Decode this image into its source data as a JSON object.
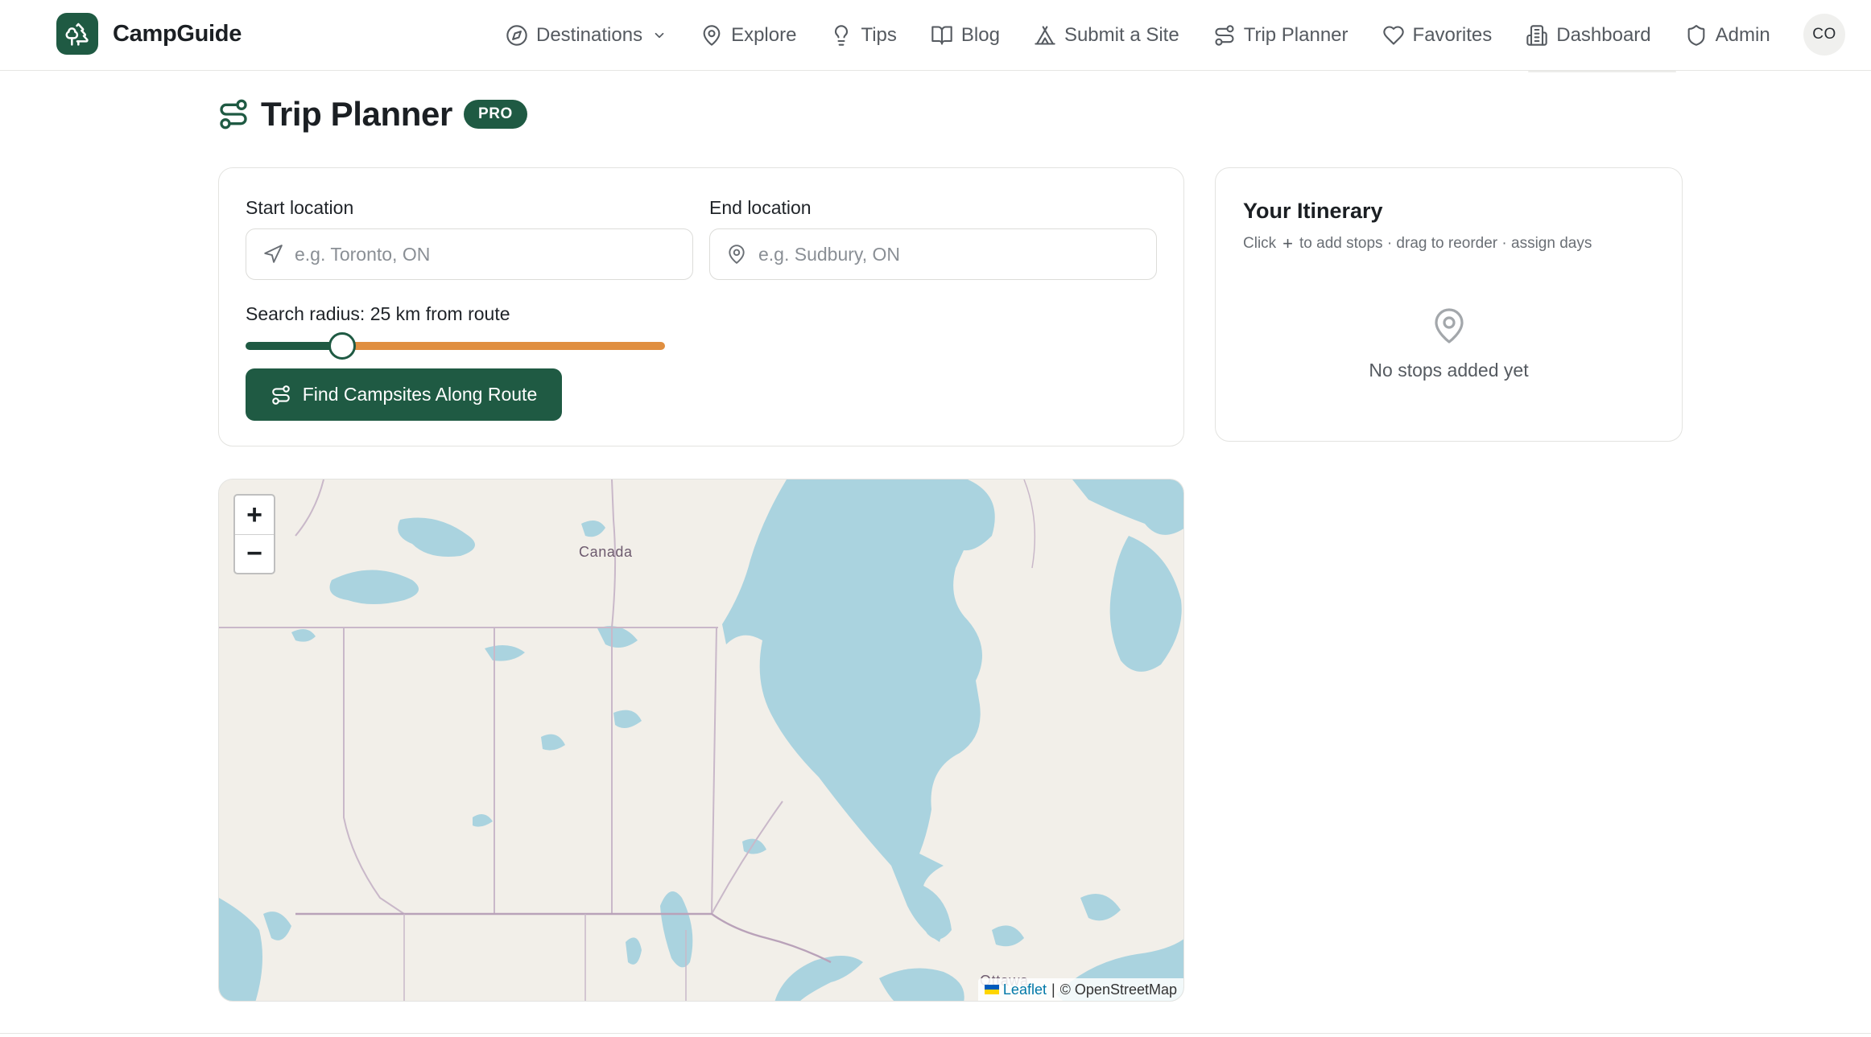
{
  "brand": {
    "name": "CampGuide"
  },
  "nav": {
    "items": [
      {
        "label": "Destinations",
        "icon": "compass-icon"
      },
      {
        "label": "Explore",
        "icon": "map-pin-icon"
      },
      {
        "label": "Tips",
        "icon": "lightbulb-icon"
      },
      {
        "label": "Blog",
        "icon": "book-icon"
      },
      {
        "label": "Submit a Site",
        "icon": "tent-icon"
      },
      {
        "label": "Trip Planner",
        "icon": "route-icon"
      },
      {
        "label": "Favorites",
        "icon": "heart-icon"
      },
      {
        "label": "Dashboard",
        "icon": "building-icon"
      },
      {
        "label": "Admin",
        "icon": "shield-icon"
      }
    ],
    "avatar_initials": "CO"
  },
  "page": {
    "title": "Trip Planner",
    "badge": "PRO"
  },
  "route_form": {
    "start_label": "Start location",
    "start_placeholder": "e.g. Toronto, ON",
    "start_value": "",
    "end_label": "End location",
    "end_placeholder": "e.g. Sudbury, ON",
    "end_value": "",
    "radius_label": "Search radius: 25 km from route",
    "radius_fraction": 0.23,
    "find_button": "Find Campsites Along Route"
  },
  "itinerary": {
    "title": "Your Itinerary",
    "hint_before": "Click",
    "hint_plus": "+",
    "hint_after": "to add stops · drag to reorder · assign days",
    "empty_text": "No stops added yet"
  },
  "map": {
    "zoom_in": "+",
    "zoom_out": "−",
    "place_labels": [
      "Canada",
      "Ottawa"
    ],
    "attribution_link": "Leaflet",
    "attribution_sep": "|",
    "attribution_text": "© OpenStreetMap",
    "water_color": "#aad3df",
    "land_color": "#f2efe9",
    "border_color": "#c9b8c9"
  },
  "colors": {
    "brand_green": "#1f5a43",
    "slider_rest": "#e08f40"
  }
}
